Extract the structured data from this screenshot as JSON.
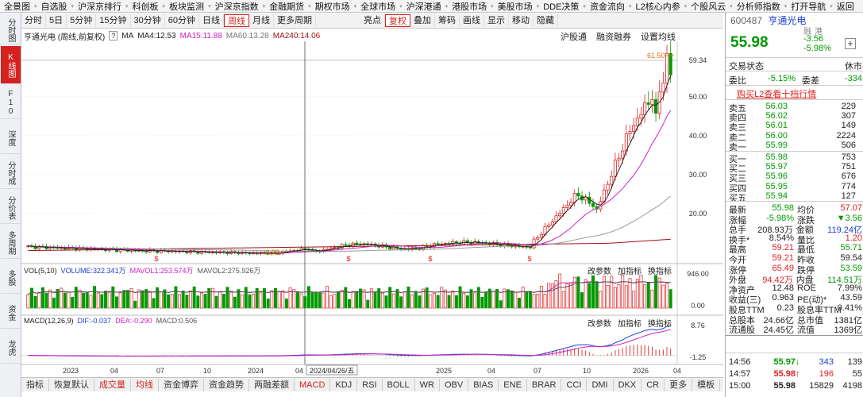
{
  "menubar": [
    "全景图",
    "自选股",
    "沪深京排行",
    "科创板",
    "板块监测",
    "沪深京指数",
    "金融期货",
    "期权市场",
    "全球市场",
    "沪深港通",
    "港股市场",
    "美股市场",
    "DDE决策",
    "资金流向",
    "L2核心内参",
    "个股风云",
    "分析师指数",
    "打开导航",
    "返回"
  ],
  "leftnav": [
    {
      "label": "分时图",
      "active": false
    },
    {
      "label": "K线图",
      "active": true
    },
    {
      "label": "F10资料",
      "active": false
    },
    {
      "label": "深度F9",
      "active": false
    },
    {
      "label": "分时成交",
      "active": false
    },
    {
      "label": "分价表",
      "active": false
    },
    {
      "label": "多周期",
      "active": false
    },
    {
      "label": "多股",
      "active": false
    },
    {
      "label": "资金",
      "active": false
    },
    {
      "label": "龙虎",
      "active": false
    }
  ],
  "toolbar": [
    "分时",
    "5日",
    "5分钟",
    "15分钟",
    "30分钟",
    "60分钟",
    "日线",
    "周线",
    "月线",
    "更多周期",
    "亮点",
    "复权",
    "叠加",
    "筹码",
    "画线",
    "显示",
    "移动",
    "隐藏"
  ],
  "toolbar_active": "周线",
  "toolbar_red": "复权",
  "chart_info": {
    "title": "亨通光电 (周线,前复权)",
    "help": "?",
    "ma": "MA",
    "ma4": "MA4:12.53",
    "ma15": "MA15:11.88",
    "ma60": "MA60:13.28",
    "ma240": "MA240:14.06"
  },
  "top_links": [
    "沪股通",
    "融资融券",
    "设置均线"
  ],
  "colors": {
    "up": "#e02020",
    "down": "#009a00",
    "ma4": "#222222",
    "ma15": "#d020c0",
    "ma60": "#999999",
    "ma240": "#a01010",
    "blue": "#1a3fcc"
  },
  "price_axis": [
    "59.34",
    "50.00",
    "40.00",
    "30.00",
    "20.00"
  ],
  "annotations": {
    "max": "61.50",
    "min": "9.73",
    "crosshair_date": "2024/04/26/五",
    "s_marks": [
      "$",
      "$",
      "$",
      "$"
    ]
  },
  "vol_info": {
    "name": "VOL(5,10)",
    "volume": "VOLUME:322.341万",
    "mavol1": "MAVOL1:253.574万",
    "mavol2": "MAVOL2:275.926万"
  },
  "vol_axis": [
    "946.00",
    "0.00"
  ],
  "macd_info": {
    "name": "MACD(12,26,9)",
    "dif": "DIF:-0.037",
    "dea": "DEA:-0.290",
    "macd": "MACD:0.506"
  },
  "macd_axis": [
    "8.76",
    "-1.25"
  ],
  "panel_tools": [
    "改参数",
    "加指标",
    "换指标"
  ],
  "x_axis": [
    "2023",
    "04",
    "07",
    "10",
    "2024",
    "04",
    "2025",
    "04",
    "07",
    "10",
    "2026",
    "04"
  ],
  "bottom_tabs": [
    "指标",
    "恢复默认",
    "成交量",
    "均线",
    "资金博弈",
    "资金趋势",
    "两融差额",
    "MACD",
    "KDJ",
    "RSI",
    "BOLL",
    "WR",
    "OBV",
    "BIAS",
    "ENE",
    "BRAR",
    "CCI",
    "DMI",
    "DKX",
    "CR",
    "更多",
    "模板"
  ],
  "stock": {
    "code": "600487",
    "name": "亨通光电",
    "tags": [
      "融",
      "港"
    ],
    "price": "55.98",
    "change": "-3.56",
    "pct": "-5.98%"
  },
  "trade_status": {
    "label": "交易状态",
    "value": "休市"
  },
  "weibi": {
    "l1": "委比",
    "v1": "-5.15%",
    "l2": "委差",
    "v2": "-334"
  },
  "l2_link": "购买L2查看十档行情",
  "asks": [
    {
      "label": "卖五",
      "price": "56.03",
      "vol": "229"
    },
    {
      "label": "卖四",
      "price": "56.02",
      "vol": "307"
    },
    {
      "label": "卖三",
      "price": "56.01",
      "vol": "149"
    },
    {
      "label": "卖二",
      "price": "56.00",
      "vol": "2224"
    },
    {
      "label": "卖一",
      "price": "55.99",
      "vol": "506"
    }
  ],
  "bids": [
    {
      "label": "买一",
      "price": "55.98",
      "vol": "753"
    },
    {
      "label": "买二",
      "price": "55.97",
      "vol": "751"
    },
    {
      "label": "买三",
      "price": "55.96",
      "vol": "676"
    },
    {
      "label": "买四",
      "price": "55.95",
      "vol": "774"
    },
    {
      "label": "买五",
      "price": "55.94",
      "vol": "127"
    }
  ],
  "stats": [
    {
      "l1": "最新",
      "v1": "55.98",
      "c1": "g",
      "l2": "均价",
      "v2": "57.07",
      "c2": "r"
    },
    {
      "l1": "涨幅",
      "v1": "-5.98%",
      "c1": "g",
      "l2": "涨跌",
      "v2": "▼3.56",
      "c2": "g"
    },
    {
      "l1": "总手",
      "v1": "208.93万",
      "c1": "",
      "l2": "金额",
      "v2": "119.24亿",
      "c2": "b"
    },
    {
      "l1": "换手*",
      "v1": "8.54%",
      "c1": "",
      "l2": "量比",
      "v2": "1.20",
      "c2": "r"
    },
    {
      "l1": "最高",
      "v1": "59.21",
      "c1": "r",
      "l2": "最低",
      "v2": "55.71",
      "c2": "g"
    },
    {
      "l1": "今开",
      "v1": "59.21",
      "c1": "r",
      "l2": "昨收",
      "v2": "59.54",
      "c2": ""
    },
    {
      "l1": "涨停",
      "v1": "65.49",
      "c1": "r",
      "l2": "跌停",
      "v2": "53.59",
      "c2": "g"
    },
    {
      "l1": "外盘",
      "v1": "94.42万",
      "c1": "r",
      "l2": "内盘",
      "v2": "114.51万",
      "c2": "g"
    },
    {
      "l1": "净资产",
      "v1": "12.48",
      "c1": "",
      "l2": "ROE",
      "v2": "7.99%",
      "c2": ""
    },
    {
      "l1": "收益(三)",
      "v1": "0.963",
      "c1": "",
      "l2": "PE(动)*",
      "v2": "43.59",
      "c2": ""
    },
    {
      "l1": "股息TTM",
      "v1": "0.23",
      "c1": "",
      "l2": "股息率TTM",
      "v2": "0.41%",
      "c2": ""
    },
    {
      "l1": "总股本",
      "v1": "24.66亿",
      "c1": "",
      "l2": "总市值",
      "v2": "1381亿",
      "c2": ""
    },
    {
      "l1": "流通股",
      "v1": "24.45亿",
      "c1": "",
      "l2": "流值",
      "v2": "1369亿",
      "c2": ""
    }
  ],
  "ticks": [
    {
      "time": "14:56",
      "price": "55.97",
      "arrow": "↓",
      "vol": "343",
      "num": "139",
      "pc": "g",
      "vc": "b"
    },
    {
      "time": "14:57",
      "price": "55.98",
      "arrow": "↑",
      "vol": "196",
      "num": "55",
      "pc": "r",
      "vc": "r"
    },
    {
      "time": "15:00",
      "price": "55.98",
      "arrow": "",
      "vol": "15829",
      "num": "4198",
      "pc": "",
      "vc": ""
    }
  ]
}
